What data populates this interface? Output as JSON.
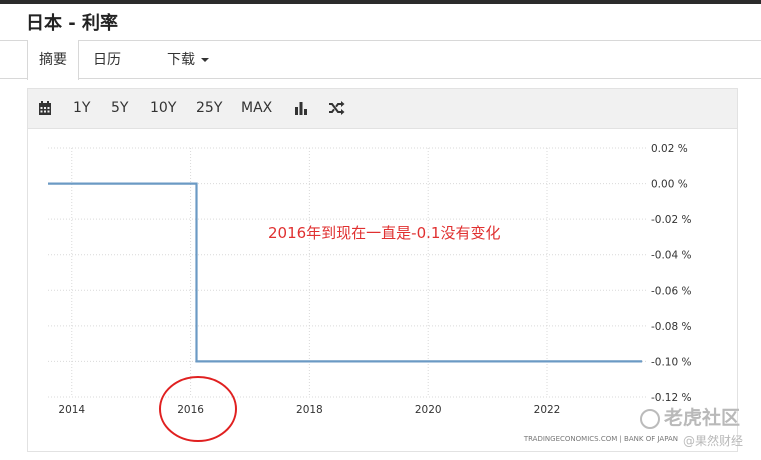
{
  "page": {
    "title": "日本 - 利率"
  },
  "tabs": [
    {
      "label": "摘要",
      "active": true
    },
    {
      "label": "日历",
      "active": false
    },
    {
      "label": "下载",
      "active": false,
      "dropdown": true
    }
  ],
  "toolbar": {
    "calendar_icon": "calendar-icon",
    "ranges": [
      "1Y",
      "5Y",
      "10Y",
      "25Y",
      "MAX"
    ],
    "bar_chart_icon": "bar-chart-icon",
    "shuffle_icon": "shuffle-icon"
  },
  "chart_data": {
    "type": "line",
    "title": "",
    "xlabel": "",
    "ylabel": "",
    "x_ticks": [
      "2014",
      "2016",
      "2018",
      "2020",
      "2022"
    ],
    "y_ticks": [
      "0.02 %",
      "0.00 %",
      "-0.02 %",
      "-0.04 %",
      "-0.06 %",
      "-0.08 %",
      "-0.10 %",
      "-0.12 %"
    ],
    "ylim": [
      -0.12,
      0.02
    ],
    "xlim": [
      2013.6,
      2023.7
    ],
    "series": [
      {
        "color": "#6b9ac4",
        "step": true,
        "points": [
          {
            "x": 2013.6,
            "y": 0.0
          },
          {
            "x": 2016.1,
            "y": 0.0
          },
          {
            "x": 2016.1,
            "y": -0.1
          },
          {
            "x": 2023.6,
            "y": -0.1
          }
        ]
      }
    ],
    "grid": true,
    "annotation": {
      "text": "2016年到现在一直是-0.1没有变化",
      "color": "#e03030"
    },
    "circled_tick": "2016",
    "source": "TRADINGECONOMICS.COM  |  BANK OF JAPAN"
  },
  "watermarks": {
    "main": "老虎社区",
    "sub": "@果然财经"
  }
}
